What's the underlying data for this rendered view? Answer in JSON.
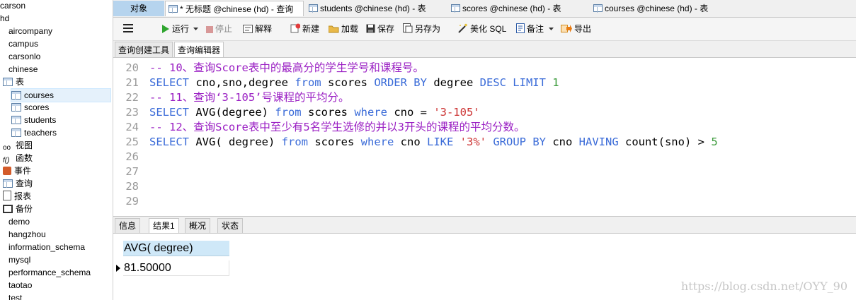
{
  "sidebar": {
    "items": [
      {
        "label": "carson",
        "kind": "db"
      },
      {
        "label": "hd",
        "kind": "db"
      },
      {
        "label": "aircompany",
        "kind": "db"
      },
      {
        "label": "campus",
        "kind": "db"
      },
      {
        "label": "carsonlo",
        "kind": "db"
      },
      {
        "label": "chinese",
        "kind": "db-open"
      },
      {
        "label": "表",
        "kind": "folder"
      },
      {
        "label": "courses",
        "kind": "table"
      },
      {
        "label": "scores",
        "kind": "table"
      },
      {
        "label": "students",
        "kind": "table"
      },
      {
        "label": "teachers",
        "kind": "table"
      },
      {
        "label": "视图",
        "kind": "view"
      },
      {
        "label": "函数",
        "kind": "func"
      },
      {
        "label": "事件",
        "kind": "event"
      },
      {
        "label": "查询",
        "kind": "query"
      },
      {
        "label": "报表",
        "kind": "report"
      },
      {
        "label": "备份",
        "kind": "backup"
      },
      {
        "label": "demo",
        "kind": "db"
      },
      {
        "label": "hangzhou",
        "kind": "db"
      },
      {
        "label": "information_schema",
        "kind": "db"
      },
      {
        "label": "mysql",
        "kind": "db"
      },
      {
        "label": "performance_schema",
        "kind": "db"
      },
      {
        "label": "taotao",
        "kind": "db"
      },
      {
        "label": "test",
        "kind": "db"
      }
    ]
  },
  "tabs": [
    {
      "label": "对象"
    },
    {
      "label": "* 无标题 @chinese (hd) - 查询"
    },
    {
      "label": "students @chinese (hd) - 表"
    },
    {
      "label": "scores @chinese (hd) - 表"
    },
    {
      "label": "courses @chinese (hd) - 表"
    }
  ],
  "toolbar": {
    "run": "运行",
    "stop": "停止",
    "explain": "解释",
    "new": "新建",
    "load": "加载",
    "save": "保存",
    "save_as": "另存为",
    "beautify": "美化 SQL",
    "comment": "备注",
    "export": "导出"
  },
  "subtabs": [
    "查询创建工具",
    "查询编辑器"
  ],
  "editor": {
    "line_numbers": [
      "20",
      "21",
      "22",
      "23",
      "24",
      "25",
      "26",
      "27",
      "28",
      "29"
    ],
    "lines": [
      [
        {
          "t": "cm",
          "v": "-- 10、查询Score表中的最高分的学生学号和课程号。"
        }
      ],
      [
        {
          "t": "kw",
          "v": "SELECT "
        },
        {
          "t": "id",
          "v": "cno,sno,degree "
        },
        {
          "t": "kw",
          "v": "from "
        },
        {
          "t": "id",
          "v": "scores "
        },
        {
          "t": "kw",
          "v": "ORDER BY "
        },
        {
          "t": "id",
          "v": "degree "
        },
        {
          "t": "kw",
          "v": "DESC LIMIT "
        },
        {
          "t": "nm",
          "v": "1"
        }
      ],
      [
        {
          "t": "cm",
          "v": "-- 11、查询‘3-105’号课程的平均分。"
        }
      ],
      [
        {
          "t": "kw",
          "v": "SELECT "
        },
        {
          "t": "id",
          "v": "AVG(degree) "
        },
        {
          "t": "kw",
          "v": "from "
        },
        {
          "t": "id",
          "v": "scores "
        },
        {
          "t": "kw",
          "v": "where "
        },
        {
          "t": "id",
          "v": "cno = "
        },
        {
          "t": "st",
          "v": "'3-105'"
        }
      ],
      [
        {
          "t": "cm",
          "v": "-- 12、查询Score表中至少有5名学生选修的并以3开头的课程的平均分数。"
        }
      ],
      [
        {
          "t": "kw",
          "v": "SELECT "
        },
        {
          "t": "id",
          "v": "AVG( degree) "
        },
        {
          "t": "kw",
          "v": "from "
        },
        {
          "t": "id",
          "v": "scores "
        },
        {
          "t": "kw",
          "v": "where "
        },
        {
          "t": "id",
          "v": "cno "
        },
        {
          "t": "kw",
          "v": "LIKE "
        },
        {
          "t": "st",
          "v": "'3%' "
        },
        {
          "t": "kw",
          "v": "GROUP BY "
        },
        {
          "t": "id",
          "v": "cno "
        },
        {
          "t": "kw",
          "v": "HAVING "
        },
        {
          "t": "id",
          "v": "count(sno) > "
        },
        {
          "t": "nm",
          "v": "5"
        }
      ],
      [],
      [],
      [],
      []
    ]
  },
  "result_tabs": [
    "信息",
    "结果1",
    "概况",
    "状态"
  ],
  "result": {
    "column": "AVG( degree)",
    "value": "81.50000"
  },
  "watermark": "https://blog.csdn.net/OYY_90"
}
